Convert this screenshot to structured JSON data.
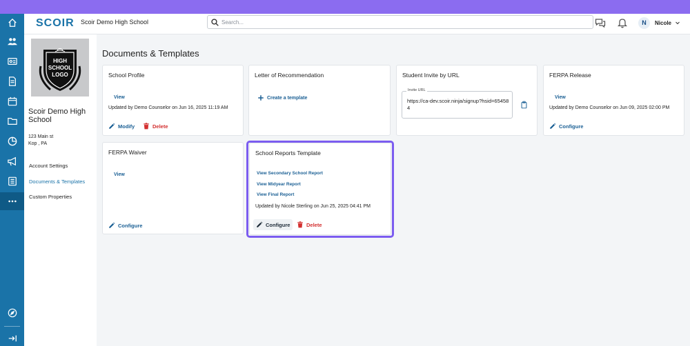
{
  "header": {
    "logo": "SCOIR",
    "school_name": "Scoir Demo High School",
    "search_placeholder": "Search...",
    "user_initial": "N",
    "user_name": "Nicole"
  },
  "rail": {
    "icons": [
      "home-icon",
      "users-icon",
      "id-card-icon",
      "document-icon",
      "calendar-icon",
      "folder-icon",
      "chart-icon",
      "megaphone-icon",
      "list-icon",
      "more-icon",
      "compass-icon",
      "collapse-icon"
    ]
  },
  "left_panel": {
    "logo_lines": [
      "HIGH",
      "SCHOOL",
      "LOGO"
    ],
    "school_name": "Scoir Demo High School",
    "address_line1": "123 Main st",
    "address_line2": "Kop , PA",
    "nav": [
      {
        "label": "Account Settings",
        "active": false
      },
      {
        "label": "Documents & Templates",
        "active": true
      },
      {
        "label": "Custom Properties",
        "active": false
      }
    ]
  },
  "page": {
    "title": "Documents & Templates"
  },
  "cards": {
    "school_profile": {
      "title": "School Profile",
      "view_label": "View",
      "updated": "Updated by Demo Counselor on Jun 16, 2025 11:19 AM",
      "modify_label": "Modify",
      "delete_label": "Delete"
    },
    "letter_of_recommendation": {
      "title": "Letter of Recommendation",
      "create_label": "Create a template"
    },
    "student_invite": {
      "title": "Student Invite by URL",
      "url_legend": "Invite URL",
      "url_value": "https://ca-dev.scoir.ninja/signup?hsid=654584"
    },
    "ferpa_release": {
      "title": "FERPA Release",
      "view_label": "View",
      "updated": "Updated by Demo Counselor on Jun 09, 2025 02:00 PM",
      "configure_label": "Configure"
    },
    "ferpa_waiver": {
      "title": "FERPA Waiver",
      "view_label": "View",
      "configure_label": "Configure"
    },
    "school_reports": {
      "title": "School Reports Template",
      "link_secondary": "View Secondary School Report",
      "link_midyear": "View Midyear Report",
      "link_final": "View Final Report",
      "updated": "Updated by Nicole Sterling on Jun 25, 2025 04:41 PM",
      "configure_label": "Configure",
      "delete_label": "Delete"
    }
  },
  "colors": {
    "brand": "#1a73a8",
    "highlight": "#7b5cf0",
    "danger": "#d32f2f",
    "top_strip": "#8b6cf0"
  }
}
